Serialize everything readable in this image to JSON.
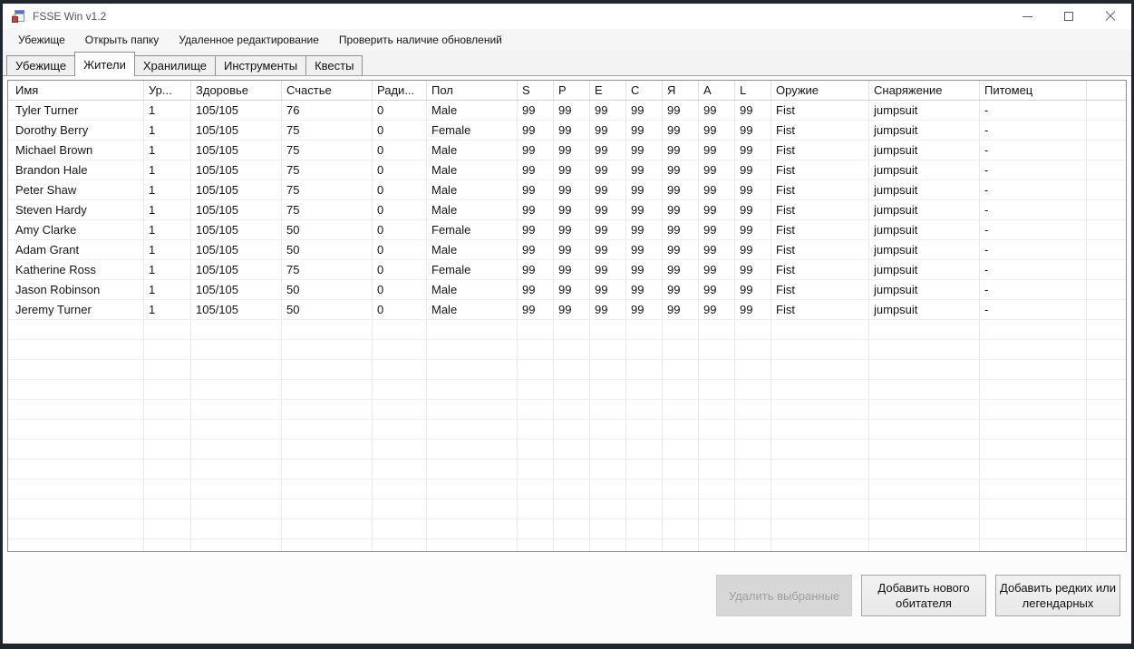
{
  "window": {
    "title": "FSSE Win v1.2",
    "icons": {
      "app": "form-icon",
      "minimize": "minimize-icon",
      "maximize": "maximize-icon",
      "close": "close-icon"
    }
  },
  "menu": {
    "items": [
      {
        "key": "vault",
        "label": "Убежище"
      },
      {
        "key": "open-folder",
        "label": "Открыть папку"
      },
      {
        "key": "remote-editing",
        "label": "Удаленное редактирование"
      },
      {
        "key": "check-updates",
        "label": "Проверить наличие обновлений"
      }
    ]
  },
  "tabs": [
    {
      "key": "vault",
      "label": "Убежище",
      "active": false
    },
    {
      "key": "dwellers",
      "label": "Жители",
      "active": true
    },
    {
      "key": "storage",
      "label": "Хранилище",
      "active": false
    },
    {
      "key": "tools",
      "label": "Инструменты",
      "active": false
    },
    {
      "key": "quests",
      "label": "Квесты",
      "active": false
    }
  ],
  "table": {
    "columns": [
      {
        "key": "name",
        "label": "Имя"
      },
      {
        "key": "level",
        "label": "Ур..."
      },
      {
        "key": "health",
        "label": "Здоровье"
      },
      {
        "key": "happiness",
        "label": "Счастье"
      },
      {
        "key": "radiation",
        "label": "Ради..."
      },
      {
        "key": "gender",
        "label": "Пол"
      },
      {
        "key": "s",
        "label": "S"
      },
      {
        "key": "p",
        "label": "P"
      },
      {
        "key": "e",
        "label": "E"
      },
      {
        "key": "c",
        "label": "C"
      },
      {
        "key": "i",
        "label": "Я"
      },
      {
        "key": "a",
        "label": "A"
      },
      {
        "key": "l",
        "label": "L"
      },
      {
        "key": "weapon",
        "label": "Оружие"
      },
      {
        "key": "outfit",
        "label": "Снаряжение"
      },
      {
        "key": "pet",
        "label": "Питомец"
      }
    ],
    "rows": [
      [
        "Tyler Turner",
        "1",
        "105/105",
        "76",
        "0",
        "Male",
        "99",
        "99",
        "99",
        "99",
        "99",
        "99",
        "99",
        "Fist",
        "jumpsuit",
        "-"
      ],
      [
        "Dorothy Berry",
        "1",
        "105/105",
        "75",
        "0",
        "Female",
        "99",
        "99",
        "99",
        "99",
        "99",
        "99",
        "99",
        "Fist",
        "jumpsuit",
        "-"
      ],
      [
        "Michael Brown",
        "1",
        "105/105",
        "75",
        "0",
        "Male",
        "99",
        "99",
        "99",
        "99",
        "99",
        "99",
        "99",
        "Fist",
        "jumpsuit",
        "-"
      ],
      [
        "Brandon Hale",
        "1",
        "105/105",
        "75",
        "0",
        "Male",
        "99",
        "99",
        "99",
        "99",
        "99",
        "99",
        "99",
        "Fist",
        "jumpsuit",
        "-"
      ],
      [
        "Peter Shaw",
        "1",
        "105/105",
        "75",
        "0",
        "Male",
        "99",
        "99",
        "99",
        "99",
        "99",
        "99",
        "99",
        "Fist",
        "jumpsuit",
        "-"
      ],
      [
        "Steven Hardy",
        "1",
        "105/105",
        "75",
        "0",
        "Male",
        "99",
        "99",
        "99",
        "99",
        "99",
        "99",
        "99",
        "Fist",
        "jumpsuit",
        "-"
      ],
      [
        "Amy Clarke",
        "1",
        "105/105",
        "50",
        "0",
        "Female",
        "99",
        "99",
        "99",
        "99",
        "99",
        "99",
        "99",
        "Fist",
        "jumpsuit",
        "-"
      ],
      [
        "Adam Grant",
        "1",
        "105/105",
        "50",
        "0",
        "Male",
        "99",
        "99",
        "99",
        "99",
        "99",
        "99",
        "99",
        "Fist",
        "jumpsuit",
        "-"
      ],
      [
        "Katherine Ross",
        "1",
        "105/105",
        "75",
        "0",
        "Female",
        "99",
        "99",
        "99",
        "99",
        "99",
        "99",
        "99",
        "Fist",
        "jumpsuit",
        "-"
      ],
      [
        "Jason Robinson",
        "1",
        "105/105",
        "50",
        "0",
        "Male",
        "99",
        "99",
        "99",
        "99",
        "99",
        "99",
        "99",
        "Fist",
        "jumpsuit",
        "-"
      ],
      [
        "Jeremy Turner",
        "1",
        "105/105",
        "50",
        "0",
        "Male",
        "99",
        "99",
        "99",
        "99",
        "99",
        "99",
        "99",
        "Fist",
        "jumpsuit",
        "-"
      ]
    ],
    "empty_rows": 12
  },
  "buttons": [
    {
      "key": "delete-selected",
      "label": "Удалить выбранные",
      "enabled": false
    },
    {
      "key": "add-dweller",
      "label": "Добавить нового обитателя",
      "enabled": true
    },
    {
      "key": "add-rare-legendary",
      "label": "Добавить редких или легендарных",
      "enabled": true
    }
  ],
  "colors": {
    "frame": "#20262d",
    "titlebar": "#ffffff",
    "menubar": "#f6f6f6",
    "tab_active_bg": "#ffffff",
    "tab_inactive_bg": "#f0f0f0",
    "grid_border": "#8f8f8f",
    "gridline": "#e8e8e8",
    "disabled_button_bg": "#d7d7d7",
    "disabled_button_text": "#9e9e9e"
  }
}
